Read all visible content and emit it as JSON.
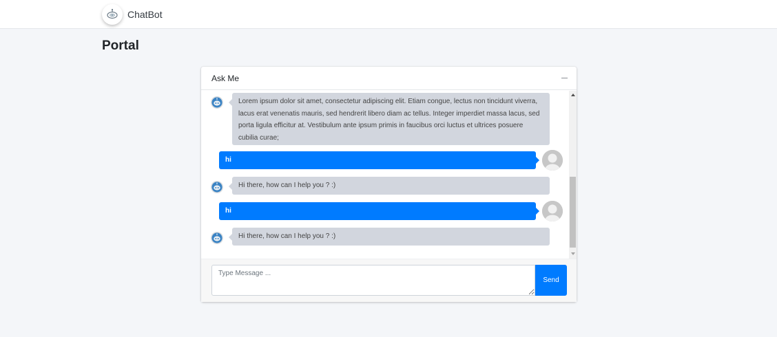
{
  "navbar": {
    "brand_name": "ChatBot",
    "logo_icon": "robot-icon"
  },
  "page": {
    "title": "Portal"
  },
  "chat": {
    "title": "Ask Me",
    "collapse_icon": "minus-icon",
    "bot_avatar_icon": "robot-icon",
    "user_avatar_icon": "user-icon",
    "messages": [
      {
        "sender": "bot",
        "text": "Lorem ipsum dolor sit amet, consectetur adipiscing elit. Etiam congue, lectus non tincidunt viverra, lacus erat venenatis mauris, sed hendrerit libero diam ac tellus. Integer imperdiet massa lacus, sed porta ligula efficitur at. Vestibulum ante ipsum primis in faucibus orci luctus et ultrices posuere cubilia curae;"
      },
      {
        "sender": "user",
        "text": "hi"
      },
      {
        "sender": "bot",
        "text": "Hi there, how can I help you ? :)"
      },
      {
        "sender": "user",
        "text": "hi"
      },
      {
        "sender": "bot",
        "text": "Hi there, how can I help you ? :)"
      }
    ],
    "input_placeholder": "Type Message ...",
    "input_value": "",
    "send_label": "Send",
    "colors": {
      "user_bubble": "#007bff",
      "bot_bubble": "#d2d6de",
      "send_button": "#007bff"
    }
  }
}
